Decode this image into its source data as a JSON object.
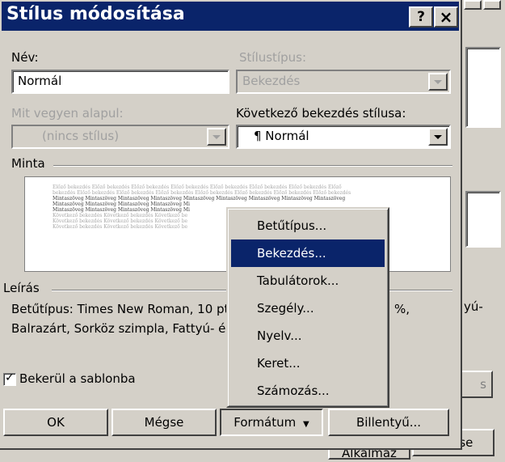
{
  "background_window": {
    "frag_cancel": "Mégse",
    "frag_right_text": "yú-",
    "frag_s": "s",
    "frag_bottom_left": "Alkalmaz"
  },
  "dialog": {
    "title": "Stílus módosítása",
    "help_glyph": "?",
    "close_glyph": "×",
    "name_label": "Név:",
    "name_value": "Normál",
    "style_type_label": "Stílustípus:",
    "style_type_value": "Bekezdés",
    "based_on_label": "Mit vegyen alapul:",
    "based_on_value": "(nincs stílus)",
    "next_style_label": "Következő bekezdés stílusa:",
    "next_style_value": "¶ Normál",
    "preview_label": "Minta",
    "preview_lines": [
      "Előző bekezdés Előző bekezdés Előző bekezdés Előző bekezdés Előző bekezdés Előző bekezdés Előző bekezdés Előző",
      "bekezdés Előző bekezdés Előző bekezdés Előző bekezdés Előző bekezdés Előző bekezdés Előző bekezdés Előző bekezdés",
      "Mintaszöveg Mintaszöveg Mintaszöveg Mintaszöveg Mintaszöveg Mintaszöveg Mintaszöveg Mintaszöveg Mintaszöveg",
      "Mintaszöveg Mintaszöveg Mintaszöveg Mintaszöveg Mi",
      "Mintaszöveg Mintaszöveg Mintaszöveg Mintaszöveg Mi",
      "Következő bekezdés Következő bekezdés Következő be",
      "Következő bekezdés Következő bekezdés Következő be",
      "Következő bekezdés Következő bekezdés Következő be"
    ],
    "description_label": "Leírás",
    "description_line1": "Betűtípus: Times New Roman, 10 pt",
    "description_line1_tail": "%,",
    "description_line2": "Balrazárt, Sorköz szimpla, Fattyú- é",
    "add_to_template_label": "Bekerül a sablonba",
    "add_to_template_checked": true,
    "ok_label": "OK",
    "cancel_label": "Mégse",
    "format_label": "Formátum",
    "shortcut_label": "Billentyű..."
  },
  "format_menu": {
    "items": [
      {
        "label": "Betűtípus...",
        "selected": false
      },
      {
        "label": "Bekezdés...",
        "selected": true
      },
      {
        "label": "Tabulátorok...",
        "selected": false
      },
      {
        "label": "Szegély...",
        "selected": false
      },
      {
        "label": "Nyelv...",
        "selected": false
      },
      {
        "label": "Keret...",
        "selected": false
      },
      {
        "label": "Számozás...",
        "selected": false
      }
    ]
  },
  "colors": {
    "title_bar": "#0a246a",
    "selection": "#0a246a",
    "face": "#d4d0c8"
  }
}
